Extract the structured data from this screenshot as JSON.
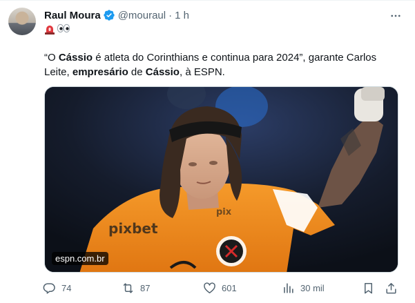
{
  "tweet": {
    "author": {
      "display_name": "Raul Moura",
      "handle": "@mouraul",
      "verified": true
    },
    "time": "1 h",
    "separator": "·",
    "emoji_line": [
      "🚨",
      "👀"
    ],
    "text_segments": [
      {
        "text": "“O ",
        "bold": false
      },
      {
        "text": "Cássio",
        "bold": true
      },
      {
        "text": " é atleta do Corinthians e continua para 2024”, garante Carlos Leite, ",
        "bold": false
      },
      {
        "text": "empresário",
        "bold": true
      },
      {
        "text": " de ",
        "bold": false
      },
      {
        "text": "Cássio",
        "bold": true
      },
      {
        "text": ", à ESPN.",
        "bold": false
      }
    ],
    "media": {
      "source_label": "espn.com.br"
    },
    "actions": {
      "replies": "74",
      "reposts": "87",
      "likes": "601",
      "views": "30 mil"
    }
  },
  "colors": {
    "text": "#0f1419",
    "secondary": "#536471",
    "verified": "#1d9bf0",
    "jersey": "#f08a1f"
  },
  "icons": [
    "verified-badge-icon",
    "more-icon",
    "siren-icon",
    "eyes-icon",
    "reply-icon",
    "repost-icon",
    "like-icon",
    "views-icon",
    "bookmark-icon",
    "share-icon"
  ]
}
